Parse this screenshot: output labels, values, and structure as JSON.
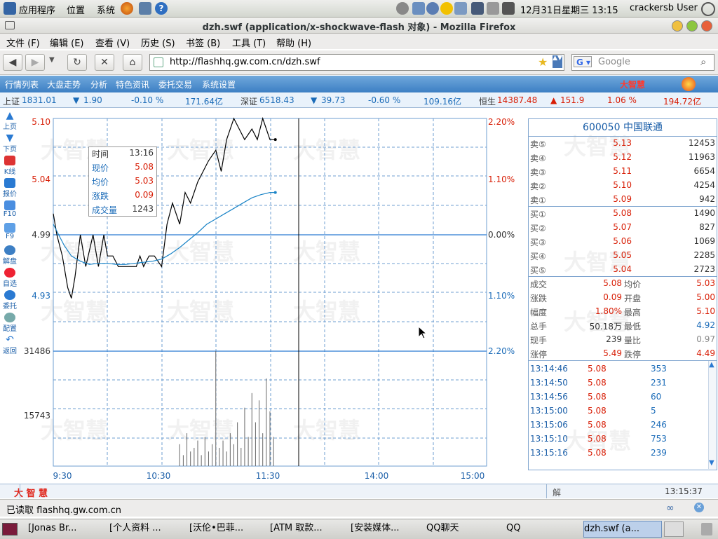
{
  "gnome_panel": {
    "menus": [
      "应用程序",
      "位置",
      "系统"
    ],
    "datetime": "12月31日星期三 13:15",
    "user": "crackersb User"
  },
  "window": {
    "title": "dzh.swf (application/x-shockwave-flash 对象) - Mozilla Firefox"
  },
  "firefox_menu": [
    "文件 (F)",
    "编辑 (E)",
    "查看 (V)",
    "历史 (S)",
    "书签 (B)",
    "工具 (T)",
    "帮助 (H)"
  ],
  "url": "http://flashhq.gw.com.cn/dzh.swf",
  "search_placeholder": "Google",
  "app": {
    "menu": [
      "行情列表",
      "大盘走势",
      "分析",
      "特色资讯",
      "委托交易",
      "系统设置"
    ],
    "brand": "大智慧"
  },
  "ticker": [
    {
      "name": "上证",
      "value": "1831.01",
      "arrow": "▼",
      "change": "1.90",
      "pct": "-0.10 %",
      "amount": "171.64亿"
    },
    {
      "name": "深证",
      "value": "6518.43",
      "arrow": "▼",
      "change": "39.73",
      "pct": "-0.60 %",
      "amount": "109.16亿"
    },
    {
      "name": "恒生",
      "value": "14387.48",
      "arrow": "▲",
      "change": "151.9",
      "pct": "1.06 %",
      "amount": "194.72亿"
    }
  ],
  "toolbar": [
    "上页",
    "下页",
    "K线",
    "报价",
    "F10",
    "F9",
    "解盘",
    "自选",
    "委托",
    "配置",
    "返回"
  ],
  "chart_data": {
    "type": "line",
    "title": "",
    "x_ticks": [
      "9:30",
      "10:30",
      "11:30",
      "14:00",
      "15:00"
    ],
    "price_ticks": [
      "5.10",
      "5.04",
      "4.99",
      "4.93"
    ],
    "pct_ticks": [
      "2.20%",
      "1.10%",
      "0.00%",
      "1.10%",
      "2.20%"
    ],
    "volume_ticks": [
      "31486",
      "15743"
    ],
    "ylim": [
      4.88,
      5.1
    ],
    "prev_close": 4.99,
    "series": [
      {
        "name": "现价",
        "color": "#000000",
        "x": [
          0,
          2,
          5,
          8,
          10,
          12,
          15,
          18,
          22,
          25,
          28,
          30,
          33,
          36,
          40,
          43,
          46,
          48,
          50,
          53,
          56,
          60,
          63,
          66,
          70,
          73,
          76,
          80,
          83,
          86,
          90,
          93,
          96,
          100,
          103,
          106,
          110,
          113,
          116,
          120,
          123
        ],
        "values": [
          5.01,
          4.99,
          4.97,
          4.94,
          4.93,
          4.95,
          4.99,
          4.96,
          4.99,
          4.96,
          4.99,
          4.97,
          4.97,
          4.96,
          4.96,
          4.96,
          4.96,
          4.97,
          4.96,
          4.97,
          4.97,
          4.96,
          5.0,
          5.02,
          5.0,
          5.03,
          5.02,
          5.04,
          5.05,
          5.06,
          5.07,
          5.05,
          5.08,
          5.1,
          5.09,
          5.08,
          5.09,
          5.08,
          5.1,
          5.08,
          5.08
        ]
      },
      {
        "name": "均价",
        "color": "#1a84c7",
        "x": [
          0,
          3,
          6,
          10,
          15,
          20,
          25,
          30,
          35,
          40,
          45,
          50,
          55,
          60,
          65,
          70,
          75,
          80,
          85,
          90,
          95,
          100,
          105,
          110,
          115,
          120,
          123
        ],
        "values": [
          5.0,
          4.99,
          4.98,
          4.97,
          4.965,
          4.962,
          4.963,
          4.963,
          4.962,
          4.962,
          4.963,
          4.964,
          4.965,
          4.967,
          4.972,
          4.978,
          4.985,
          4.992,
          5.0,
          5.005,
          5.01,
          5.015,
          5.02,
          5.025,
          5.028,
          5.03,
          5.03
        ]
      }
    ],
    "volume": {
      "x": [
        70,
        72,
        74,
        76,
        78,
        80,
        82,
        84,
        86,
        88,
        90,
        92,
        94,
        96,
        98,
        100,
        102,
        104,
        106,
        108,
        110,
        112,
        114,
        116,
        118,
        120,
        122
      ],
      "values": [
        6000,
        3000,
        9000,
        4000,
        5000,
        7000,
        3000,
        8000,
        4000,
        6000,
        31486,
        5000,
        7000,
        4000,
        9000,
        6000,
        12000,
        5000,
        16000,
        8000,
        20000,
        12000,
        18000,
        9000,
        24000,
        15000,
        8000
      ]
    }
  },
  "tooltip": {
    "rows": [
      {
        "label": "时间",
        "value": "13:16"
      },
      {
        "label": "现价",
        "value": "5.08"
      },
      {
        "label": "均价",
        "value": "5.03"
      },
      {
        "label": "涨跌",
        "value": "0.09"
      },
      {
        "label": "成交量",
        "value": "1243"
      }
    ]
  },
  "quote": {
    "code_name": "600050 中国联通",
    "asks": [
      {
        "label": "卖⑤",
        "price": "5.13",
        "vol": "12453"
      },
      {
        "label": "卖④",
        "price": "5.12",
        "vol": "11963"
      },
      {
        "label": "卖③",
        "price": "5.11",
        "vol": "6654"
      },
      {
        "label": "卖②",
        "price": "5.10",
        "vol": "4254"
      },
      {
        "label": "卖①",
        "price": "5.09",
        "vol": "942"
      }
    ],
    "bids": [
      {
        "label": "买①",
        "price": "5.08",
        "vol": "1490"
      },
      {
        "label": "买②",
        "price": "5.07",
        "vol": "827"
      },
      {
        "label": "买③",
        "price": "5.06",
        "vol": "1069"
      },
      {
        "label": "买④",
        "price": "5.05",
        "vol": "2285"
      },
      {
        "label": "买⑤",
        "price": "5.04",
        "vol": "2723"
      }
    ],
    "stats": [
      {
        "l1": "成交",
        "v1": "5.08",
        "l2": "均价",
        "v2": "5.03"
      },
      {
        "l1": "涨跌",
        "v1": "0.09",
        "l2": "开盘",
        "v2": "5.00"
      },
      {
        "l1": "幅度",
        "v1": "1.80%",
        "l2": "最高",
        "v2": "5.10"
      },
      {
        "l1": "总手",
        "v1": "50.18万",
        "l2": "最低",
        "v2": "4.92"
      },
      {
        "l1": "现手",
        "v1": "239",
        "l2": "量比",
        "v2": "0.97"
      },
      {
        "l1": "涨停",
        "v1": "5.49",
        "l2": "跌停",
        "v2": "4.49"
      }
    ],
    "ticks": [
      {
        "time": "13:14:46",
        "price": "5.08",
        "vol": "353"
      },
      {
        "time": "13:14:50",
        "price": "5.08",
        "vol": "231"
      },
      {
        "time": "13:14:56",
        "price": "5.08",
        "vol": "60"
      },
      {
        "time": "13:15:00",
        "price": "5.08",
        "vol": "5"
      },
      {
        "time": "13:15:06",
        "price": "5.08",
        "vol": "246"
      },
      {
        "time": "13:15:10",
        "price": "5.08",
        "vol": "753"
      },
      {
        "time": "13:15:16",
        "price": "5.08",
        "vol": "239"
      }
    ]
  },
  "app_status": {
    "brand": "大 智 慧",
    "solve": "解",
    "time": "13:15:37"
  },
  "ff_status": "已读取 flashhq.gw.com.cn",
  "taskbar": [
    "[Jonas Br...",
    "[个人资料 ...",
    "[沃伦•巴菲...",
    "[ATM 取款...",
    "[安装媒体...",
    "QQ聊天",
    "QQ",
    "dzh.swf (a..."
  ],
  "colors": {
    "accent": "#3d7fc4",
    "up": "#d81e06",
    "down": "#1a6bb8"
  }
}
